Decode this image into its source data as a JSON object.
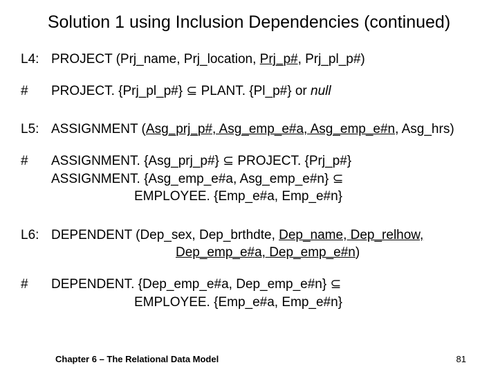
{
  "title": "Solution 1 using Inclusion Dependencies (continued)",
  "L4": {
    "label": "L4:",
    "pre": "PROJECT  (Prj_name, Prj_location, ",
    "u1": "Prj_p#",
    "mid": ", Prj_pl_p#)"
  },
  "L4c": {
    "label": "#",
    "t1": "PROJECT. {Prj_pl_p#}  ",
    "sub": "⊆",
    "t2": "  PLANT. {Pl_p#}  or ",
    "null": "null"
  },
  "L5": {
    "label": "L5:",
    "pre": "ASSIGNMENT  (",
    "u1": "Asg_prj_p#, Asg_emp_e#a, Asg_emp_e#n",
    "post": ", Asg_hrs)"
  },
  "L5c": {
    "label": "#",
    "l1a": "ASSIGNMENT. {Asg_prj_p#}  ",
    "sub": "⊆",
    "l1b": "  PROJECT. {Prj_p#}",
    "l2a": "ASSIGNMENT. {Asg_emp_e#a, Asg_emp_e#n}  ",
    "l3": "EMPLOYEE. {Emp_e#a, Emp_e#n}"
  },
  "L6": {
    "label": "L6:",
    "pre": "DEPENDENT  (Dep_sex, Dep_brthdte, ",
    "u1": "Dep_name, Dep_relhow,",
    "u2": "Dep_emp_e#a, Dep_emp_e#n",
    "post": ")"
  },
  "L6c": {
    "label": "#",
    "l1a": "DEPENDENT. {Dep_emp_e#a, Dep_emp_e#n}  ",
    "sub": "⊆",
    "l2": "EMPLOYEE. {Emp_e#a, Emp_e#n}"
  },
  "footer": {
    "chapter": "Chapter 6 – The Relational Data Model",
    "page": "81"
  }
}
